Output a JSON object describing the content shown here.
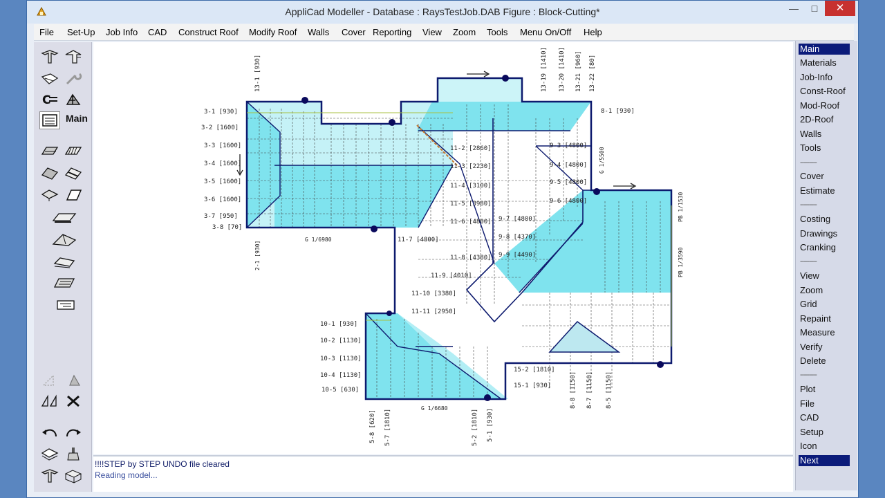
{
  "window": {
    "title": "AppliCad Modeller - Database : RaysTestJob.DAB   Figure : Block-Cutting*",
    "minimize_glyph": "—",
    "maximize_glyph": "□",
    "close_glyph": "✕"
  },
  "menubar": {
    "items": [
      "File",
      "Set-Up",
      "Job Info",
      "CAD",
      "Construct Roof",
      "Modify Roof",
      "Walls",
      "Cover",
      "Reporting",
      "View",
      "Zoom",
      "Tools",
      "Menu On/Off",
      "Help"
    ]
  },
  "toolbox": {
    "main_label": "Main",
    "icons": [
      "hip-roof-icon",
      "gable-roof-icon",
      "sheet-icon",
      "wrench-icon",
      "cutting-icon",
      "truss-icon",
      "main-screen-icon",
      "eave-icon",
      "batten-icon",
      "roof-plane-icon",
      "ridge-icon",
      "flashing-icon",
      "panel-icon",
      "gutter-icon",
      "valley-icon",
      "profile-icon",
      "measure-icon",
      "triangle-left-icon",
      "triangle-right-icon",
      "mirror-icon",
      "delete-icon",
      "undo-icon",
      "redo-icon",
      "layers-icon",
      "brush-icon",
      "template-icon",
      "open-box-icon"
    ]
  },
  "status": {
    "line1": "!!!!STEP by STEP UNDO file cleared",
    "line2": "Reading model..."
  },
  "right_menu": {
    "items": [
      "Main",
      "Materials",
      "Job-Info",
      "Const-Roof",
      "Mod-Roof",
      "2D-Roof",
      "Walls",
      "Tools",
      "---------",
      "Cover",
      "Estimate",
      "---------",
      "Costing",
      "Drawings",
      "Cranking",
      "---------",
      "View",
      "Zoom",
      "Grid",
      "Repaint",
      "Measure",
      "Verify",
      "Delete",
      "---------",
      "Plot",
      "File",
      "CAD",
      "Setup",
      "Icon",
      "Next"
    ],
    "active": [
      "Main",
      "Next"
    ]
  },
  "drawing": {
    "colors": {
      "roof_fill": "#7fe3ee",
      "outline": "#0d1a6e",
      "node": "#0a0a5c",
      "rafter": "#333333"
    },
    "labels_left": [
      "3-1 [930]",
      "3-2 [1600]",
      "3-3 [1600]",
      "3-4 [1600]",
      "3-5 [1600]",
      "3-6 [1600]",
      "3-7 [950]",
      "3-8 [70]"
    ],
    "labels_right": [
      "8-1 [930]",
      "9-3 [4800]",
      "9-4 [4800]",
      "9-5 [4800]",
      "9-6 [4800]",
      "9-7 [4800]",
      "9-8 [4370]",
      "9-9 [4490]"
    ],
    "labels_center": [
      "11-2 [2860]",
      "11-3 [2230]",
      "11-4 [3100]",
      "11-5 [3980]",
      "11-6 [4800]",
      "11-8 [4380]",
      "11-9 [4010]",
      "11-10 [3380]",
      "11-11 [2950]",
      "11-7 [4800]"
    ],
    "labels_bottom_left": [
      "10-1 [930]",
      "10-2 [1130]",
      "10-3 [1130]",
      "10-4 [1130]",
      "10-5 [630]"
    ],
    "labels_bottom": [
      "5-8 [620]",
      "5-7 [1810]",
      "5-2 [1810]",
      "5-1 [930]",
      "8-8 [1150]",
      "8-7 [1150]",
      "8-5 [1150]",
      "15-1 [930]",
      "15-2 [1810]"
    ],
    "labels_top": [
      "13-1 [930]",
      "13-19 [1410]",
      "13-20 [1410]",
      "13-21 [960]",
      "13-22 [80]"
    ],
    "labels_misc": [
      "G 1/6980",
      "G 1/6680",
      "G 1/5500",
      "PB 1/3590",
      "PB 1/1530",
      "2-1 [930]"
    ]
  }
}
